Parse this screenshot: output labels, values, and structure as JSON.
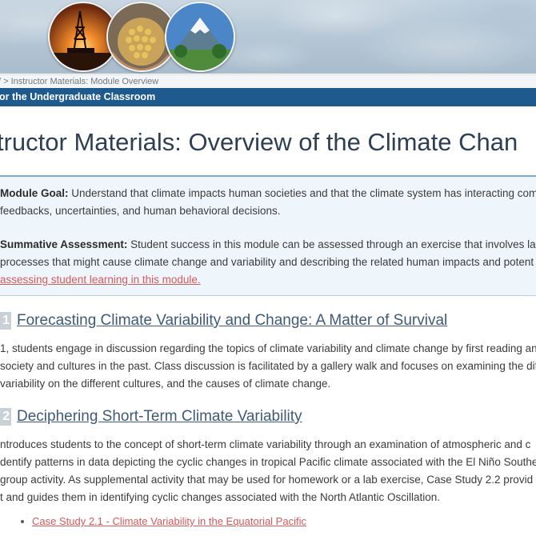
{
  "breadcrumb": "/ > Instructor Materials: Module Overview",
  "site_bar": "or the Undergraduate Classroom",
  "page_title": "tructor Materials: Overview of the Climate Chan",
  "module_goal": {
    "label": "Module Goal:",
    "line1": " Understand that climate impacts human societies and that the climate system has interacting com",
    "line2": "feedbacks, uncertainties, and human behavioral decisions."
  },
  "summative": {
    "label": "Summative Assessment:",
    "line1": " Student success in this module can be assessed through an exercise that involves labe",
    "line2": "processes that might cause climate change and variability and describing the related human impacts and potent",
    "link": "assessing student learning in this module."
  },
  "units": [
    {
      "number": "1",
      "title": "Forecasting Climate Variability and Change: A Matter of Survival",
      "lines": [
        "1, students engage in discussion regarding the topics of climate variability and climate change by first reading an",
        "society and cultures in the past. Class discussion is facilitated by a gallery walk and focuses on examining the dif",
        "variability on the different cultures, and the causes of climate change."
      ]
    },
    {
      "number": "2",
      "title": "Deciphering Short-Term Climate Variability",
      "lines": [
        "ntroduces students to the concept of short-term climate variability through an examination of atmospheric and c",
        "dentify patterns in data depicting the cyclic changes in tropical Pacific climate associated with the El Niño Southe",
        "group activity. As supplemental activity that may be used for homework or a lab exercise, Case Study 2.2 provid",
        "t and guides them in identifying cyclic changes associated with the North Atlantic Oscillation."
      ],
      "case_link": "Case Study 2.1 - Climate Variability in the Equatorial Pacific"
    }
  ],
  "banner_images": [
    "oil-rig-sunset-photo",
    "corn-kernels-photo",
    "snowy-volcano-photo"
  ],
  "colors": {
    "title_bar": "#1f5a8f",
    "heading": "#2d3f55",
    "link": "#d45a5a",
    "unit_link": "#3f5a78"
  }
}
